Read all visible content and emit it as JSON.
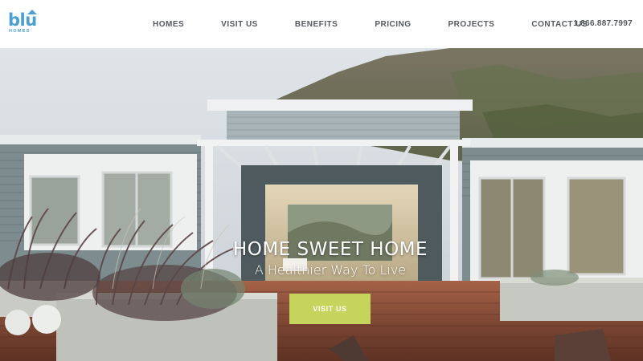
{
  "brand": {
    "name": "blu",
    "tagline": "HOMES"
  },
  "nav": {
    "items": [
      {
        "label": "HOMES"
      },
      {
        "label": "VISIT US"
      },
      {
        "label": "BENEFITS"
      },
      {
        "label": "PRICING"
      },
      {
        "label": "PROJECTS"
      },
      {
        "label": "CONTACT US"
      }
    ],
    "phone": "1.866.887.7997"
  },
  "hero": {
    "title": "HOME SWEET HOME",
    "subtitle": "A Healthier Way To Live",
    "cta_label": "VISIT US"
  },
  "colors": {
    "brand_blue": "#4a9fd6",
    "cta_green": "#c5d45b",
    "nav_text": "#555a60"
  }
}
